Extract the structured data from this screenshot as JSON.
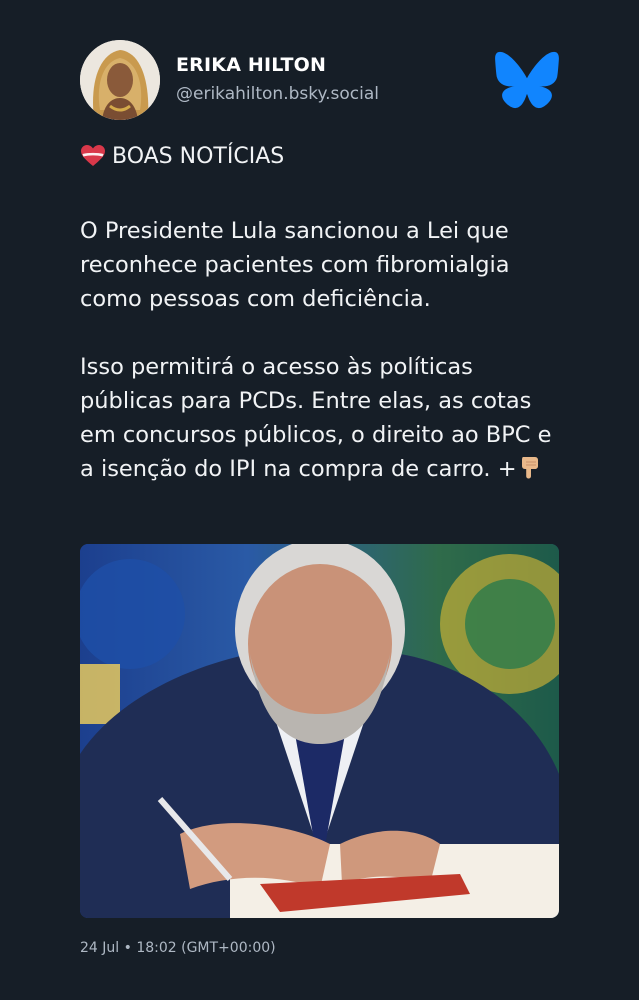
{
  "author": {
    "name": "ERIKA HILTON",
    "handle": "@erikahilton.bsky.social"
  },
  "post": {
    "heading": "BOAS NOTÍCIAS",
    "heading_icon": "heart-icon",
    "paragraph_1": "O Presidente Lula sancionou a Lei que reconhece pacientes com fibromialgia como pessoas com deficiência.",
    "paragraph_2": "Isso permitirá o acesso às políticas públicas para PCDs. Entre elas, as cotas em concursos públicos, o direito ao BPC e a isenção do IPI na compra de carro. +",
    "trailing_icon": "pointing-down-hand-icon",
    "timestamp": "24 Jul • 18:02 (GMT+00:00)"
  },
  "brand": {
    "logo": "bluesky-butterfly-icon",
    "accent_color": "#1185fe",
    "background_color": "#161e27"
  }
}
